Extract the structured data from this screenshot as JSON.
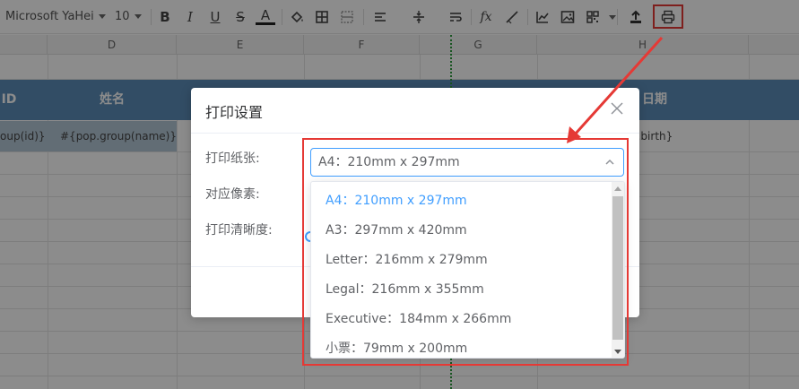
{
  "toolbar": {
    "font_family": "Microsoft YaHei",
    "font_size": "10",
    "fx_label": "fx",
    "icons": [
      "bold-icon",
      "italic-icon",
      "underline-icon",
      "strikethrough-icon",
      "font-color-icon",
      "fill-color-icon",
      "border-icon",
      "merge-cells-icon",
      "align-icon",
      "valign-icon",
      "wrap-text-icon",
      "function-icon",
      "clear-format-icon",
      "chart-icon",
      "image-icon",
      "qrcode-icon",
      "export-icon",
      "print-icon"
    ],
    "bold_label": "B",
    "italic_label": "I",
    "underline_label": "U",
    "strike_label": "S",
    "color_label": "A"
  },
  "columns": [
    "D",
    "E",
    "F",
    "G",
    "H"
  ],
  "sheet": {
    "header_row": {
      "col_c": "ID",
      "col_d": "姓名",
      "col_h": "日期"
    },
    "data_row": {
      "col_c": "oup(id)}",
      "col_d": "#{pop.group(name)}",
      "col_h": "p.birth}"
    }
  },
  "modal": {
    "title": "打印设置",
    "labels": {
      "paper": "打印纸张:",
      "pixels": "对应像素:",
      "clarity": "打印清晰度:"
    },
    "select_value": "A4：210mm x 297mm",
    "options": [
      "A4：210mm x 297mm",
      "A3：297mm x 420mm",
      "Letter：216mm x 279mm",
      "Legal：216mm x 355mm",
      "Executive：184mm x 266mm",
      "小票：79mm x 200mm"
    ],
    "selected_index": 0
  },
  "colors": {
    "accent": "#409eff",
    "highlight": "#e53935",
    "header_fill": "#5b8db8",
    "page_break": "#2e9b3e"
  }
}
